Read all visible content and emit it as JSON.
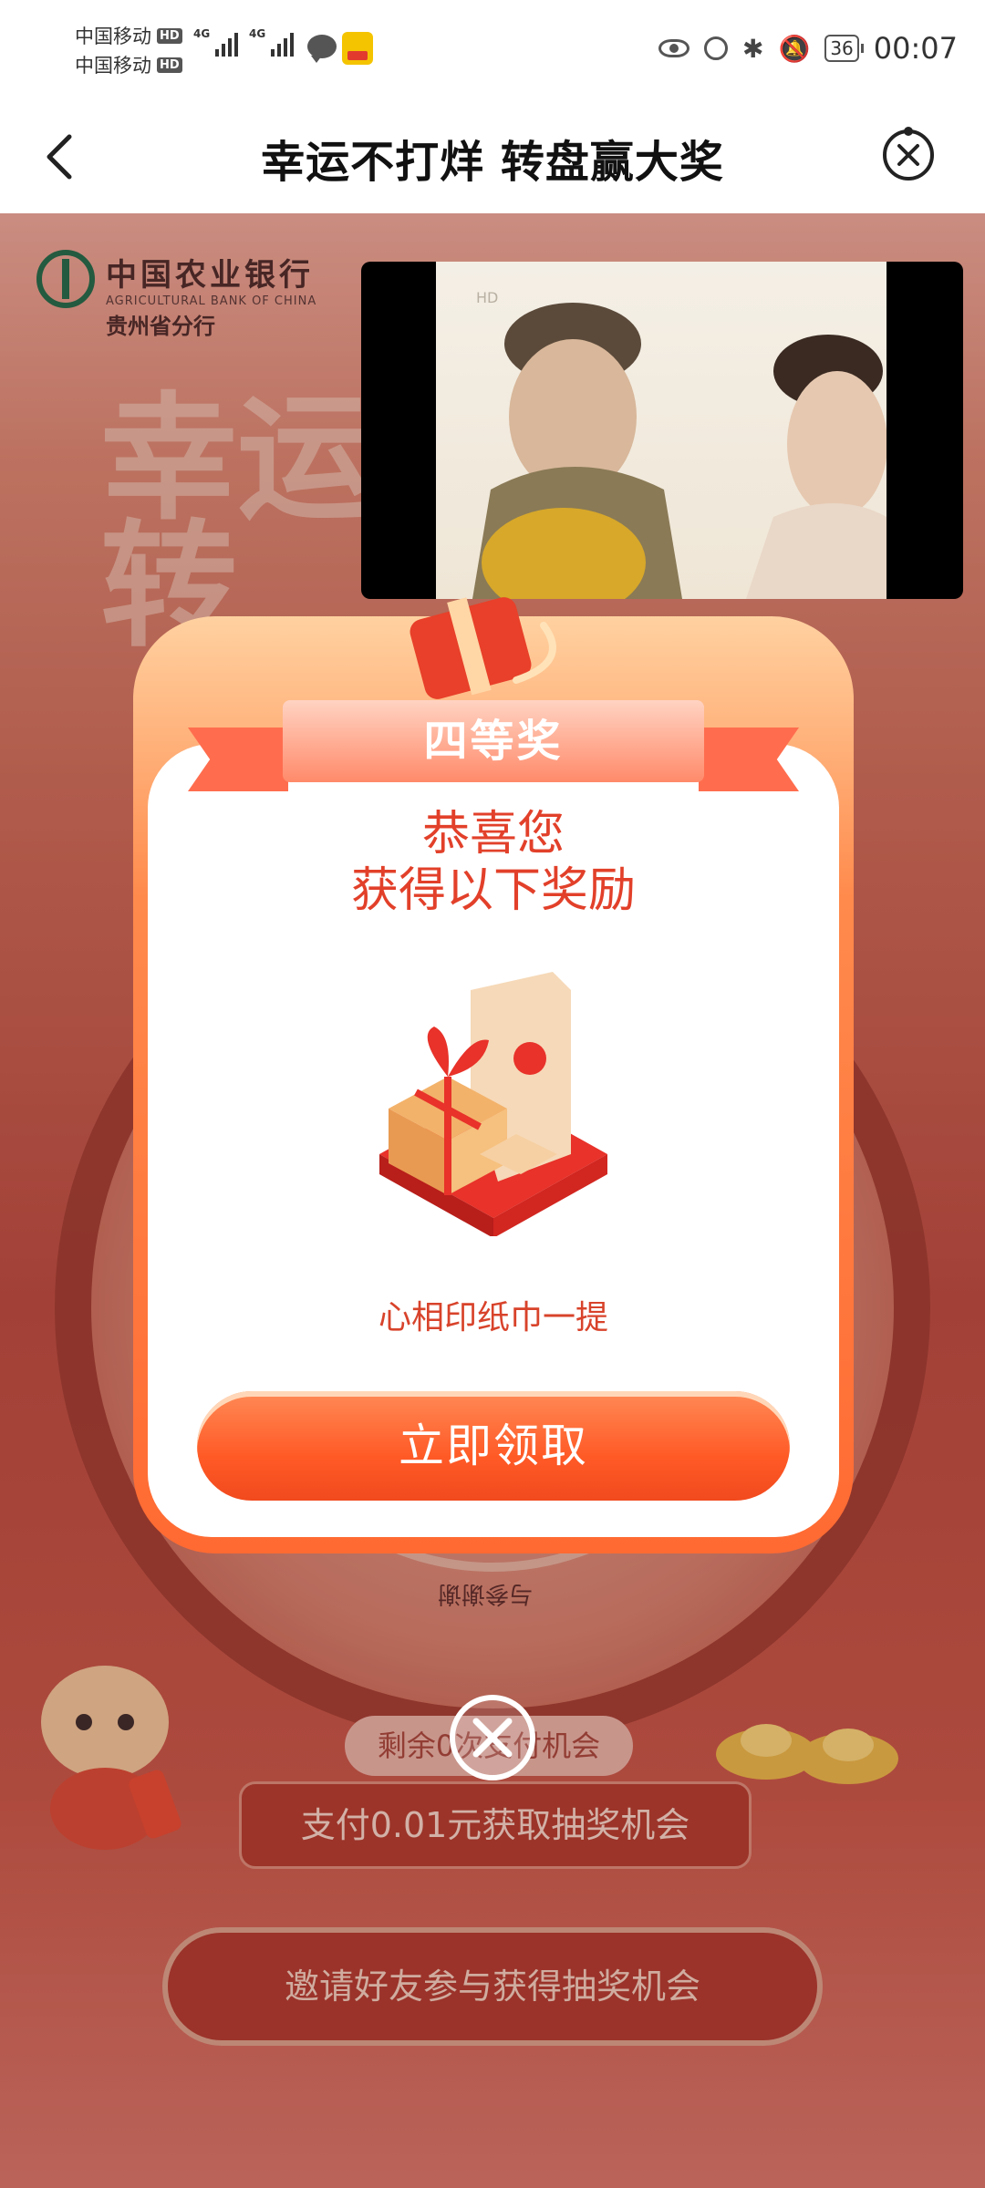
{
  "status_bar": {
    "carrier1": "中国移动",
    "carrier2": "中国移动",
    "hd_label": "HD",
    "network1": "4G",
    "network2": "4G",
    "battery": "36",
    "time": "00:07",
    "icons": [
      "message-icon",
      "app-notification-icon",
      "eye-icon",
      "alarm-icon",
      "bluetooth-icon",
      "mute-icon",
      "battery-icon"
    ]
  },
  "nav": {
    "title": "幸运不打烊 转盘赢大奖",
    "back_icon": "chevron-left-icon",
    "close_icon": "mini-program-close-icon"
  },
  "background_page": {
    "bank_name": "中国农业银行",
    "bank_name_en": "AGRICULTURAL BANK OF CHINA",
    "bank_branch": "贵州省分行",
    "hero_text": "幸运\n转",
    "wheel_segment_label": "与参谢谢",
    "remaining_text": "剩余0次支付机会",
    "pay_button": "支付0.01元获取抽奖机会",
    "invite_button": "邀请好友参与获得抽奖机会"
  },
  "video": {
    "hd_label": "HD"
  },
  "prize_modal": {
    "ribbon_label": "四等奖",
    "congrats_line1": "恭喜您",
    "congrats_line2": "获得以下奖励",
    "prize_name": "心相印纸巾一提",
    "claim_button": "立即领取",
    "close_icon": "close-circle-icon"
  },
  "colors": {
    "accent": "#ff5a26",
    "prize_text": "#e2402a",
    "bank_green": "#1f6a4a"
  }
}
